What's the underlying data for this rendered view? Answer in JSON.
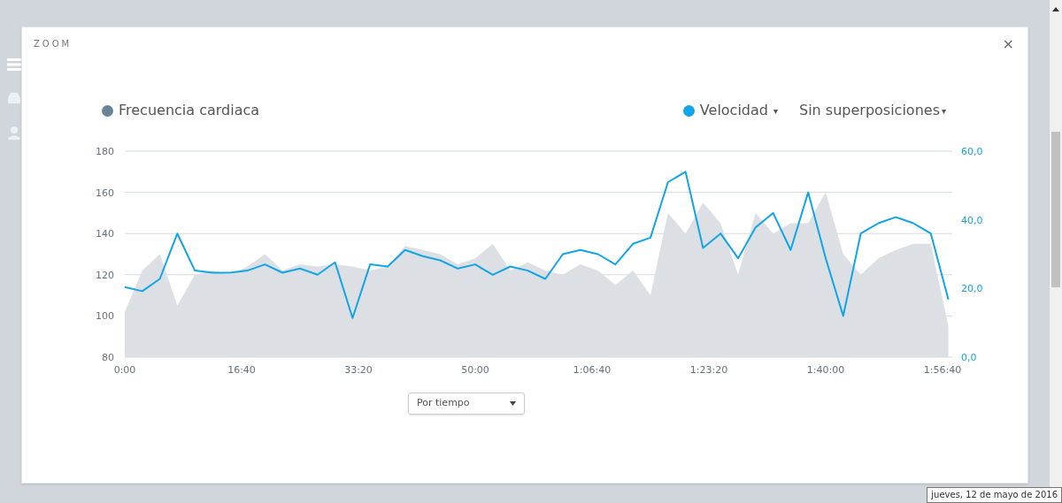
{
  "dialog": {
    "title": "ZOOM",
    "close": "×"
  },
  "legend": {
    "left": {
      "color": "#6b8396"
    },
    "right": {
      "color": "#11a5e8",
      "caret": "▾"
    },
    "overlay": {
      "label": "Sin superposiciones",
      "caret": "▾"
    }
  },
  "chart_data": {
    "type": "line",
    "grid": true,
    "xlim": [
      0,
      7083
    ],
    "ylim": [
      80,
      180
    ],
    "y2lim": [
      0,
      60
    ],
    "xticks": [
      {
        "value": 0,
        "label": "0:00"
      },
      {
        "value": 1000,
        "label": "16:40"
      },
      {
        "value": 2000,
        "label": "33:20"
      },
      {
        "value": 3000,
        "label": "50:00"
      },
      {
        "value": 4000,
        "label": "1:06:40"
      },
      {
        "value": 5000,
        "label": "1:23:20"
      },
      {
        "value": 6000,
        "label": "1:40:00"
      },
      {
        "value": 7000,
        "label": "1:56:40"
      }
    ],
    "yticks": [
      80,
      100,
      120,
      140,
      160,
      180
    ],
    "y2ticks": [
      {
        "value": 0,
        "label": "0,0"
      },
      {
        "value": 20,
        "label": "20,0"
      },
      {
        "value": 40,
        "label": "40,0"
      },
      {
        "value": 60,
        "label": "60,0"
      }
    ],
    "x": [
      0,
      150,
      300,
      450,
      600,
      750,
      900,
      1050,
      1200,
      1350,
      1500,
      1650,
      1800,
      1950,
      2100,
      2250,
      2400,
      2550,
      2700,
      2850,
      3000,
      3150,
      3300,
      3450,
      3600,
      3750,
      3900,
      4050,
      4200,
      4350,
      4500,
      4650,
      4800,
      4950,
      5100,
      5250,
      5400,
      5550,
      5700,
      5850,
      6000,
      6150,
      6300,
      6450,
      6600,
      6750,
      6900,
      7050
    ],
    "series": [
      {
        "name": "Frecuencia cardiaca",
        "color": "#dcdfe3",
        "type": "area",
        "values": [
          102,
          122,
          130,
          105,
          120,
          122,
          120,
          124,
          130,
          122,
          125,
          124,
          125,
          124,
          122,
          124,
          134,
          132,
          130,
          125,
          128,
          135,
          122,
          126,
          122,
          120,
          125,
          122,
          115,
          122,
          110,
          150,
          140,
          155,
          145,
          120,
          150,
          140,
          145,
          145,
          160,
          130,
          120,
          128,
          132,
          135,
          135,
          95
        ]
      },
      {
        "name": "Velocidad",
        "color": "#11a5e8",
        "axis": "y2",
        "values": [
          20.4,
          19.2,
          22.8,
          36,
          25.2,
          24.6,
          24.6,
          25.2,
          27,
          24.6,
          25.8,
          24,
          27.6,
          11.4,
          27,
          26.4,
          31.2,
          29.4,
          28.2,
          25.8,
          27,
          24,
          26.4,
          25.2,
          22.8,
          30,
          31.2,
          30,
          27,
          33,
          34.8,
          51,
          54,
          31.8,
          36,
          28.8,
          37.8,
          42,
          31.2,
          48,
          28.8,
          12,
          36,
          39,
          40.8,
          39,
          36,
          16.8
        ]
      }
    ]
  },
  "mode_select": {
    "value": "Por tiempo"
  },
  "tooltip": "jueves, 12 de mayo de 2016"
}
